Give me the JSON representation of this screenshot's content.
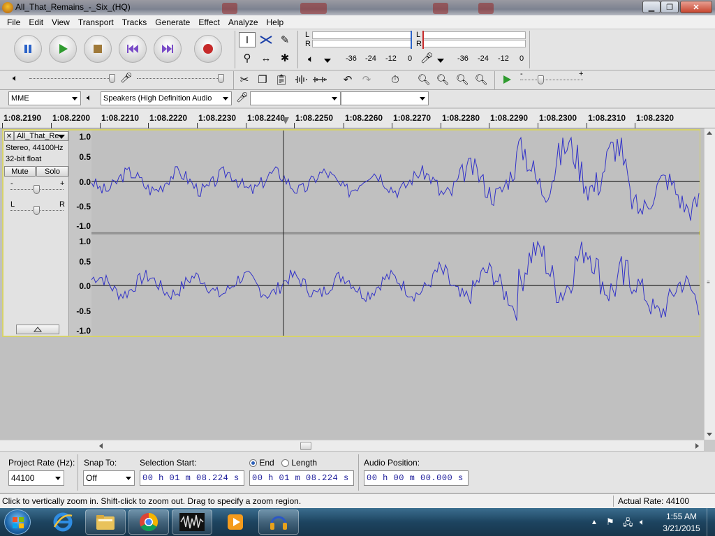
{
  "window": {
    "title": "All_That_Remains_-_Six_(HQ)"
  },
  "menu": [
    "File",
    "Edit",
    "View",
    "Transport",
    "Tracks",
    "Generate",
    "Effect",
    "Analyze",
    "Help"
  ],
  "meters": {
    "play": {
      "l": "L",
      "r": "R",
      "scale": [
        "-36",
        "-24",
        "-12",
        "0"
      ]
    },
    "record": {
      "l": "L",
      "r": "R",
      "scale": [
        "-36",
        "-24",
        "-12",
        "0"
      ]
    }
  },
  "devices": {
    "host": "MME",
    "output": "Speakers (High Definition Audio",
    "input": "",
    "channels": ""
  },
  "ruler": [
    "1:08.2190",
    "1:08.2200",
    "1:08.2210",
    "1:08.2220",
    "1:08.2230",
    "1:08.2240",
    "1:08.2250",
    "1:08.2260",
    "1:08.2270",
    "1:08.2280",
    "1:08.2290",
    "1:08.2300",
    "1:08.2310",
    "1:08.2320"
  ],
  "track": {
    "name": "All_That_Re",
    "info1": "Stereo, 44100Hz",
    "info2": "32-bit float",
    "mute": "Mute",
    "solo": "Solo",
    "gain_minus": "-",
    "gain_plus": "+",
    "pan_l": "L",
    "pan_r": "R",
    "amp_labels": [
      "1.0",
      "0.5",
      "0.0",
      "-0.5",
      "-1.0"
    ]
  },
  "selection": {
    "rate_label": "Project Rate (Hz):",
    "rate_value": "44100",
    "snap_label": "Snap To:",
    "snap_value": "Off",
    "start_label": "Selection Start:",
    "end_label": "End",
    "length_label": "Length",
    "audio_pos_label": "Audio Position:",
    "start": {
      "h": "00",
      "m": "01",
      "s": "08.224"
    },
    "end": {
      "h": "00",
      "m": "01",
      "s": "08.224"
    },
    "audio_pos": {
      "h": "00",
      "m": "00",
      "s": "00.000"
    },
    "unit_h": "h",
    "unit_m": "m",
    "unit_s": "s"
  },
  "status": {
    "message": "Click to vertically zoom in. Shift-click to zoom out. Drag to specify a zoom region.",
    "actual_rate": "Actual Rate: 44100"
  },
  "clock": {
    "time": "1:55 AM",
    "date": "3/21/2015"
  }
}
